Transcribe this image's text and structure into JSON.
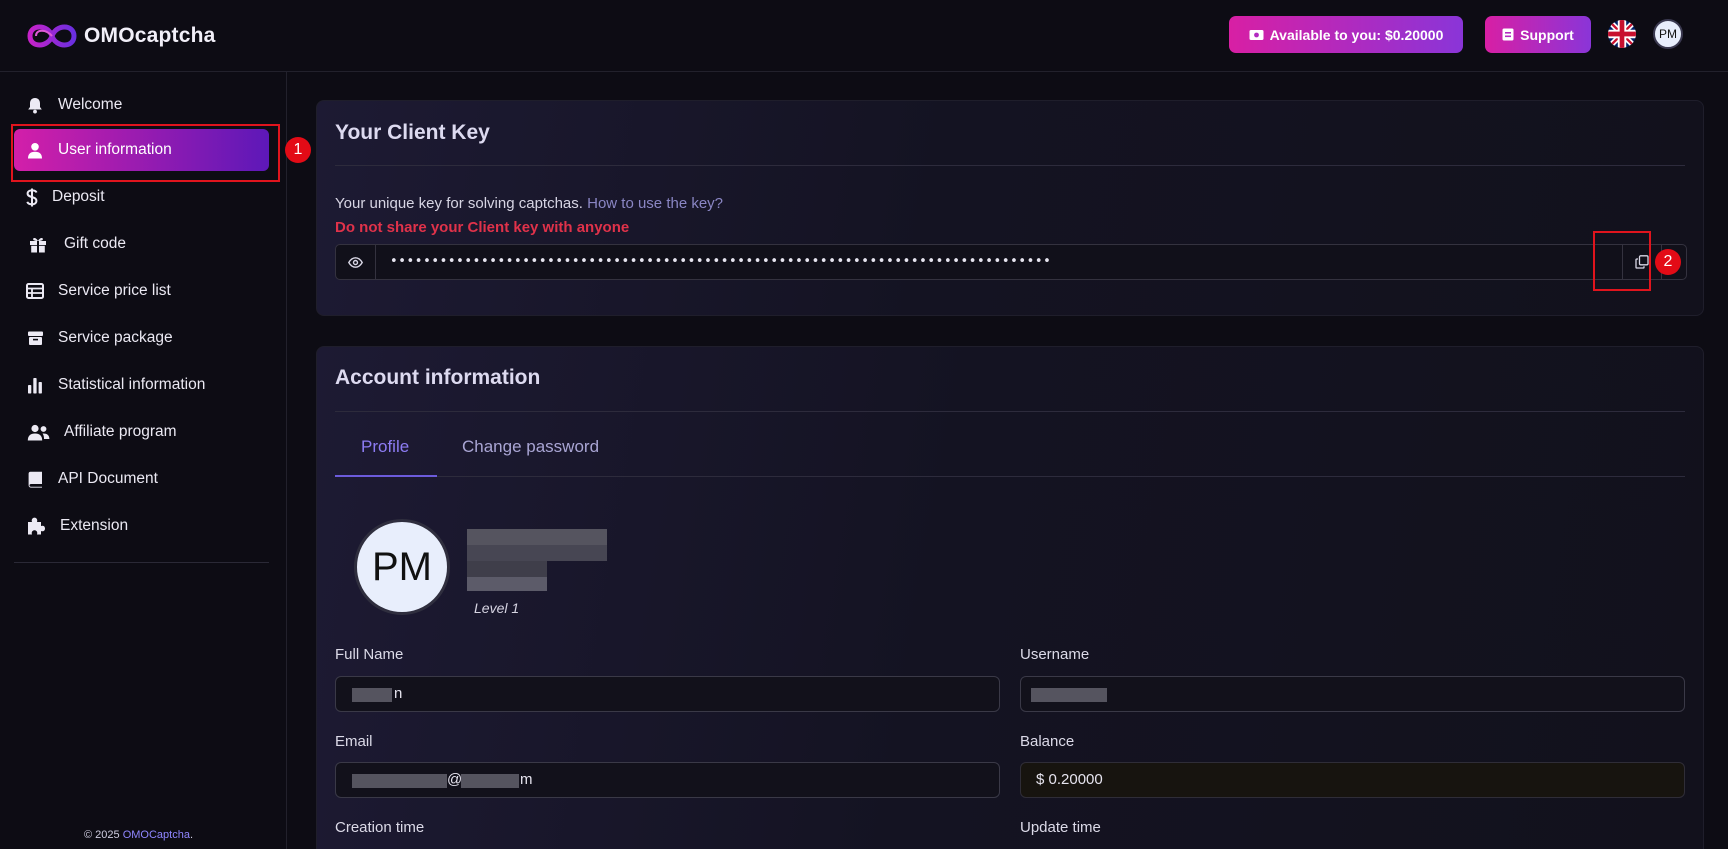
{
  "brand": {
    "name": "OMOcaptcha"
  },
  "header": {
    "balance_button": "Available to you: $0.20000",
    "support_button": "Support",
    "avatar_initials": "PM"
  },
  "sidebar": {
    "items": [
      {
        "label": "Welcome",
        "icon": "bell-icon"
      },
      {
        "label": "User information",
        "icon": "user-icon",
        "active": true
      },
      {
        "label": "Deposit",
        "icon": "dollar-icon"
      },
      {
        "label": "Gift code",
        "icon": "gift-icon"
      },
      {
        "label": "Service price list",
        "icon": "table-icon"
      },
      {
        "label": "Service package",
        "icon": "box-icon"
      },
      {
        "label": "Statistical information",
        "icon": "chart-icon"
      },
      {
        "label": "Affiliate program",
        "icon": "users-icon"
      },
      {
        "label": "API Document",
        "icon": "book-icon"
      },
      {
        "label": "Extension",
        "icon": "puzzle-icon"
      }
    ],
    "footer_prefix": "© 2025 ",
    "footer_link": "OMOCaptcha",
    "footer_suffix": "."
  },
  "annotations": {
    "mark1": "1",
    "mark2": "2"
  },
  "client_key": {
    "title": "Your Client Key",
    "description": "Your unique key for solving captchas.",
    "help_link": "How to use the key?",
    "warning": "Do not share your Client key with anyone",
    "masked_value": "••••••••••••••••••••••••••••••••••••••••••••••••••••••••••••••••••••••••••••••••"
  },
  "account": {
    "title": "Account information",
    "tabs": [
      "Profile",
      "Change password"
    ],
    "avatar_initials": "PM",
    "level": "Level 1",
    "fields": {
      "full_name_label": "Full Name",
      "full_name_value": "n",
      "username_label": "Username",
      "email_label": "Email",
      "email_value_visible": "@",
      "email_value_end": "m",
      "balance_label": "Balance",
      "balance_value": "$ 0.20000",
      "creation_time_label": "Creation time",
      "update_time_label": "Update time"
    }
  },
  "colors": {
    "accent_gradient_start": "#d81fa4",
    "accent_gradient_end": "#8a35d8",
    "warning": "#e0324a",
    "link": "#8f86ff",
    "annotation": "#e30b16"
  }
}
